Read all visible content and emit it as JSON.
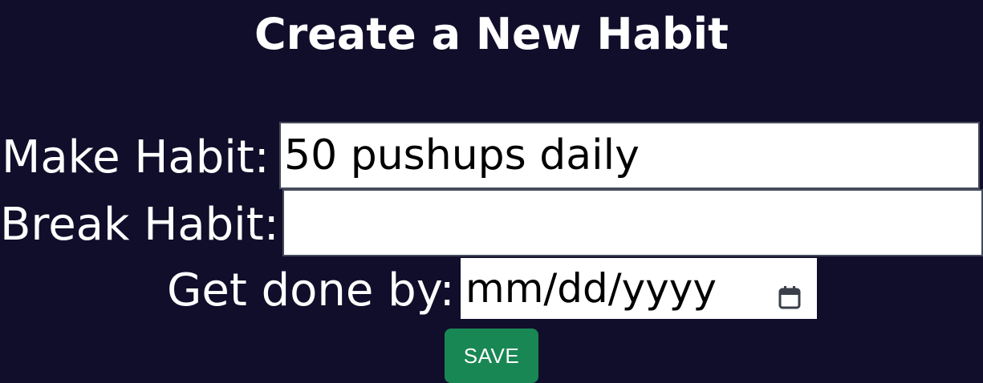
{
  "page": {
    "title": "Create a New Habit"
  },
  "form": {
    "make_habit": {
      "label": "Make Habit:",
      "value": "50 pushups daily"
    },
    "break_habit": {
      "label": "Break Habit:",
      "value": ""
    },
    "done_by": {
      "label": "Get done by:",
      "placeholder": "mm/dd/yyyy",
      "icon": "calendar-icon"
    },
    "save_label": "SAVE"
  },
  "colors": {
    "background": "#110e2b",
    "save_button": "#198754",
    "text": "#ffffff"
  }
}
